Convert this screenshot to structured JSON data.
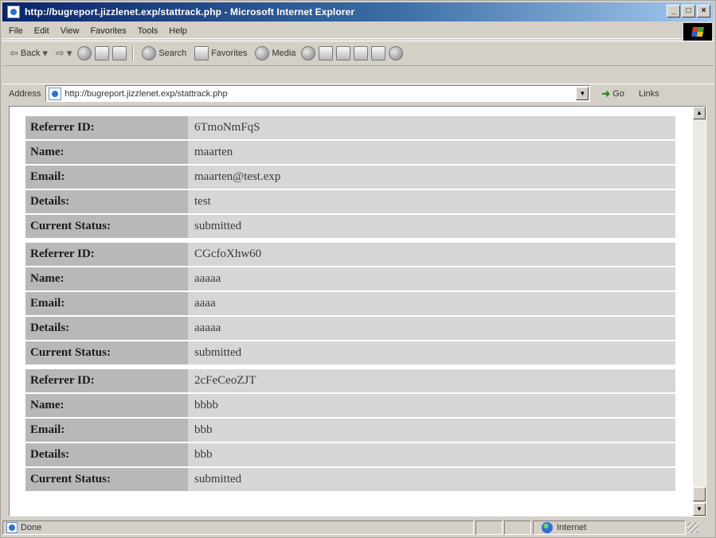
{
  "window": {
    "title": "http://bugreport.jizzlenet.exp/stattrack.php - Microsoft Internet Explorer",
    "controls": [
      "_",
      "□",
      "×"
    ]
  },
  "menu": [
    "File",
    "Edit",
    "View",
    "Favorites",
    "Tools",
    "Help"
  ],
  "toolbar": {
    "back": "Back",
    "search": "Search",
    "favorites": "Favorites",
    "media": "Media"
  },
  "address": {
    "label": "Address",
    "url": "http://bugreport.jizzlenet.exp/stattrack.php",
    "go": "Go",
    "links": "Links"
  },
  "records": [
    [
      {
        "label": "Referrer ID:",
        "value": "6TmoNmFqS"
      },
      {
        "label": "Name:",
        "value": "maarten"
      },
      {
        "label": "Email:",
        "value": "maarten@test.exp"
      },
      {
        "label": "Details:",
        "value": "test"
      },
      {
        "label": "Current Status:",
        "value": "submitted"
      }
    ],
    [
      {
        "label": "Referrer ID:",
        "value": "CGcfoXhw60"
      },
      {
        "label": "Name:",
        "value": "aaaaa"
      },
      {
        "label": "Email:",
        "value": "aaaa"
      },
      {
        "label": "Details:",
        "value": "aaaaa"
      },
      {
        "label": "Current Status:",
        "value": "submitted"
      }
    ],
    [
      {
        "label": "Referrer ID:",
        "value": "2cFeCeoZJT"
      },
      {
        "label": "Name:",
        "value": "bbbb"
      },
      {
        "label": "Email:",
        "value": "bbb"
      },
      {
        "label": "Details:",
        "value": "bbb"
      },
      {
        "label": "Current Status:",
        "value": "submitted"
      }
    ]
  ],
  "status": {
    "text": "Done",
    "zone": "Internet"
  }
}
